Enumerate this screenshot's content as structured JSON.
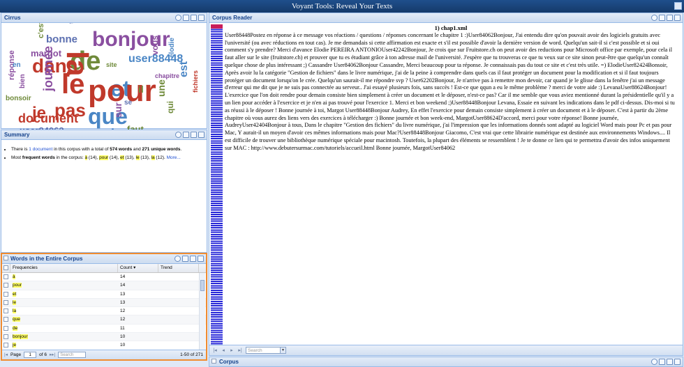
{
  "window": {
    "title": "Voyant Tools: Reveal Your Texts"
  },
  "cirrus": {
    "title": "Cirrus",
    "words": [
      {
        "t": "très",
        "c": "#5b6fb0"
      },
      {
        "t": "bonne",
        "c": "#5b6fb0"
      },
      {
        "t": "bonjour",
        "c": "#8a4fa0"
      },
      {
        "t": "c'est",
        "c": "#6f8a3a"
      },
      {
        "t": "margot",
        "c": "#8a4fa0"
      },
      {
        "t": "dans",
        "c": "#c0392b"
      },
      {
        "t": "de",
        "c": "#6f8a3a"
      },
      {
        "t": "la",
        "c": "#c0392b"
      },
      {
        "t": "à",
        "c": "#8a4fa0"
      },
      {
        "t": "user88448",
        "c": "#4a86c5"
      },
      {
        "t": "elodie",
        "c": "#4a86c5"
      },
      {
        "t": "le",
        "c": "#c0392b"
      },
      {
        "t": "et",
        "c": "#4a86c5"
      },
      {
        "t": "pour",
        "c": "#c0392b"
      },
      {
        "t": "pas",
        "c": "#c0392b"
      },
      {
        "t": "journée",
        "c": "#8a4fa0"
      },
      {
        "t": "réponse",
        "c": "#8a4fa0"
      },
      {
        "t": "bien",
        "c": "#8a4fa0"
      },
      {
        "t": "bonsoir",
        "c": "#6f8a3a"
      },
      {
        "t": "je",
        "c": "#c0392b"
      },
      {
        "t": "est",
        "c": "#4a86c5"
      },
      {
        "t": "que",
        "c": "#4a86c5"
      },
      {
        "t": "document",
        "c": "#c0392b"
      },
      {
        "t": "merci",
        "c": "#4a86c5"
      },
      {
        "t": "user84062",
        "c": "#5b6fb0"
      },
      {
        "t": "faut",
        "c": "#6f8a3a"
      },
      {
        "t": "sur",
        "c": "#8a4fa0"
      },
      {
        "t": "une",
        "c": "#6f8a3a"
      },
      {
        "t": "vous",
        "c": "#8a4fa0"
      },
      {
        "t": "qui",
        "c": "#6f8a3a"
      },
      {
        "t": "fichiers",
        "c": "#c0392b"
      },
      {
        "t": "site",
        "c": "#6f8a3a"
      },
      {
        "t": "en",
        "c": "#4a86c5"
      },
      {
        "t": "il",
        "c": "#6f8a3a"
      },
      {
        "t": "se",
        "c": "#5b6fb0"
      },
      {
        "t": "chapitre",
        "c": "#8a4fa0"
      }
    ]
  },
  "summary": {
    "title": "Summary",
    "l1_pre": "There is ",
    "l1_link": "1 document",
    "l1_mid": " in this corpus with a total of ",
    "l1_words": "574 words",
    "l1_and": " and ",
    "l1_unique": "271 unique words",
    "l1_end": ".",
    "l2_pre": "Most ",
    "l2_bold": "frequent words",
    "l2_mid": " in the corpus: ",
    "freq": [
      {
        "w": "à",
        "n": " (14), "
      },
      {
        "w": "pour",
        "n": " (14), "
      },
      {
        "w": "et",
        "n": " (13), "
      },
      {
        "w": "le",
        "n": " (13), "
      },
      {
        "w": "la",
        "n": " (12). "
      }
    ],
    "more": "More..."
  },
  "words_grid": {
    "title": "Words in the Entire Corpus",
    "col_freq": "Frequencies",
    "col_count": "Count",
    "col_trend": "Trend",
    "rows": [
      {
        "w": "à",
        "n": "14"
      },
      {
        "w": "pour",
        "n": "14"
      },
      {
        "w": "et",
        "n": "13"
      },
      {
        "w": "le",
        "n": "13"
      },
      {
        "w": "la",
        "n": "12"
      },
      {
        "w": "que",
        "n": "12"
      },
      {
        "w": "de",
        "n": "11"
      },
      {
        "w": "bonjour",
        "n": "10"
      },
      {
        "w": "je",
        "n": "10"
      },
      {
        "w": "pas",
        "n": "9"
      }
    ],
    "pager": {
      "page_label": "Page",
      "page_value": "1",
      "of_label": "of 6",
      "search_placeholder": "Search",
      "range": "1-50 of 271"
    }
  },
  "reader": {
    "title": "Corpus Reader",
    "doc_title": "1) chap1.xml",
    "text": "User88448Postez en réponse à ce message vos réactions / questions / réponses concernant le chapitre 1 :)User84062Bonjour, J'ai entendu dire qu'on pouvait avoir des logiciels gratuits avec l'université (ou avec réductions en tout cas). Je me demandais si cette affirmation est exacte et s'il est possible d'avoir la dernière version de word. Quelqu'un sait-il si c'est possible et si oui comment s'y prendre? Merci d'avance Elodie PEREIRA ANTONIOUser42242Bonjour, Je crois que sur Fruitstore.ch on peut avoir des reductions pour Microsoft office par exemple, pour cela il faut aller sur le site (fruitstore.ch) et prouver que tu es étudiant grâce à ton adresse mail de l'université. J'espère que tu trouveras ce que tu veux sur ce site sinon peut-être que quelqu'un connaît quelque chose de plus intéressant ;) Cassandre   User84062Bonjour Cassandre, Merci beaucoup pour ta réponse. Je connaissais pas du tout ce site et c'est très utile. =) ElodieUser82424Bonsoir,   Après avoir lu la catégorie \"Gestion de fichiers\" dans le livre numérique, j'ai de la peine à comprendre dans quels cas il faut protéger un document pour la modification et si il faut toujours protéger un document lorsqu'on le crée.   Quelqu'un saurait-il me répondre svp ? User62202Bonjour, Je n'arrive pas à remettre mon devoir, car quand je le glisse dans la fenêtre j'ai un message d'erreur qui me dit que je ne suis pas connectée au serveur.. J'ai essayé plusieurs fois, sans succès ! Est-ce que qqun a eu le même problème ? merci de votre aide :) LevanaUser88624Bonjour! L'exercice que l'on doit rendre pour demain consiste bien simplement à créer un document et le déposer, n'est-ce pas? Car il me semble que vous aviez mentionné durant la présidentielle qu'il y a un lien pour accéder à l'exercice et je n'en ai pas trouvé pour l'exercice 1. Merci et bon weekend ;)User88448Bonjour Levana, Essaie en suivant les indications dans le pdf ci-dessus. Dis-moi si tu as réussi à le déposer ! Bonne journée à toi, Margot  User88448Bonjour Audrey, En effet l'exercice pour demain consiste simplement à créer un document et à le déposer. C'est à partir du 2ème chapitre où vous aurez des liens vers des exercices à télécharger :) Bonne journée et bon week-end, MargotUser88624D'accord, merci pour votre réponse! Bonne journée, AudreyUser42404Bonjour à tous,   Dans le chapitre \"Gestion des fichiers\" du livre numérique, j'ai l'impression que les informations donnés sont adapté au logiciel Word mais pour Pc et pas pour Mac, Y aurait-il un moyen d'avoir ces mêmes informations mais pour Mac?User88448Bonjour Giacomo, C'est vrai que cette librairie numérique est destinée aux environnements Windows.... Il est difficile de trouver une bibliothèque numérique spéciale pour macintosh. Toutefois, la plupart des éléments se ressemblent ! Je te donne ce lien qui te permettra d'avoir des infos uniquement sur MAC : http://www.debutersurmac.com/tutoriels/accueil.html Bonne journée, MargotUser84062",
    "search_placeholder": "Search"
  },
  "corpus": {
    "title": "Corpus"
  }
}
